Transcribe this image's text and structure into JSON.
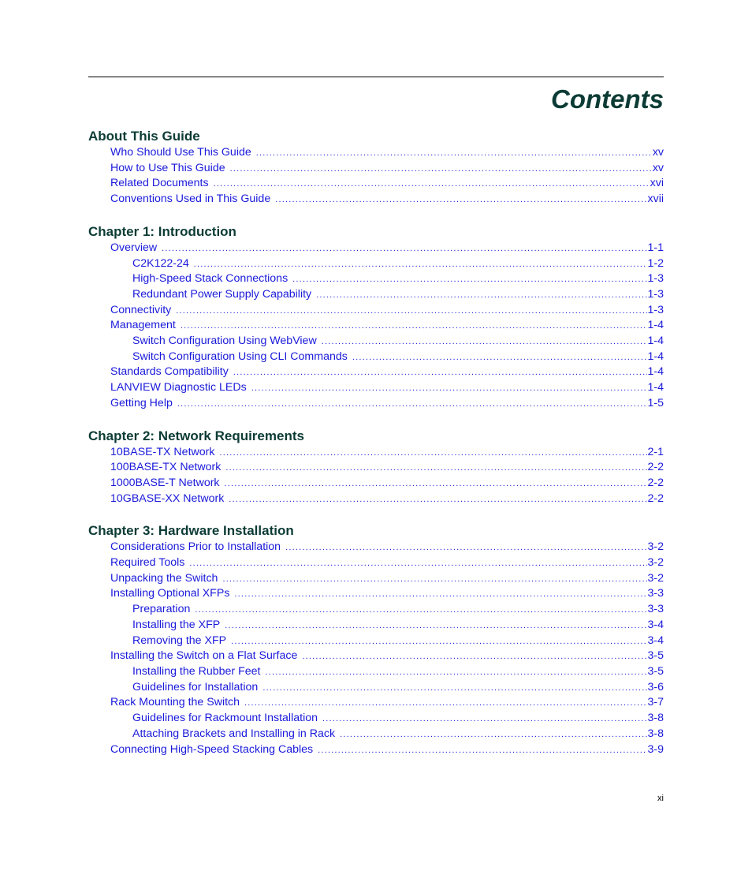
{
  "page": {
    "title": "Contents",
    "folio": "xi"
  },
  "sections": [
    {
      "title": "About This Guide",
      "entries": [
        {
          "level": 1,
          "label": "Who Should Use This Guide",
          "page": "xv"
        },
        {
          "level": 1,
          "label": "How to Use This Guide",
          "page": "xv"
        },
        {
          "level": 1,
          "label": "Related Documents",
          "page": "xvi"
        },
        {
          "level": 1,
          "label": "Conventions Used in This Guide",
          "page": "xvii"
        }
      ]
    },
    {
      "title": "Chapter 1: Introduction",
      "entries": [
        {
          "level": 1,
          "label": "Overview",
          "page": "1-1"
        },
        {
          "level": 2,
          "label": "C2K122-24",
          "page": "1-2"
        },
        {
          "level": 2,
          "label": "High-Speed Stack Connections",
          "page": "1-3"
        },
        {
          "level": 2,
          "label": "Redundant Power Supply Capability",
          "page": "1-3"
        },
        {
          "level": 1,
          "label": "Connectivity",
          "page": "1-3"
        },
        {
          "level": 1,
          "label": "Management",
          "page": "1-4"
        },
        {
          "level": 2,
          "label": "Switch Configuration Using WebView",
          "page": "1-4"
        },
        {
          "level": 2,
          "label": "Switch Configuration Using CLI Commands",
          "page": "1-4"
        },
        {
          "level": 1,
          "label": "Standards Compatibility",
          "page": "1-4"
        },
        {
          "level": 1,
          "label": "LANVIEW Diagnostic LEDs",
          "page": "1-4"
        },
        {
          "level": 1,
          "label": "Getting Help",
          "page": "1-5"
        }
      ]
    },
    {
      "title": "Chapter 2: Network Requirements",
      "entries": [
        {
          "level": 1,
          "label": "10BASE-TX Network",
          "page": "2-1"
        },
        {
          "level": 1,
          "label": "100BASE-TX Network",
          "page": "2-2"
        },
        {
          "level": 1,
          "label": "1000BASE-T Network",
          "page": "2-2"
        },
        {
          "level": 1,
          "label": "10GBASE-XX Network",
          "page": "2-2"
        }
      ]
    },
    {
      "title": "Chapter 3: Hardware Installation",
      "entries": [
        {
          "level": 1,
          "label": "Considerations Prior to Installation",
          "page": "3-2"
        },
        {
          "level": 1,
          "label": "Required Tools",
          "page": "3-2"
        },
        {
          "level": 1,
          "label": "Unpacking the Switch",
          "page": "3-2"
        },
        {
          "level": 1,
          "label": "Installing Optional XFPs",
          "page": "3-3"
        },
        {
          "level": 2,
          "label": "Preparation",
          "page": "3-3"
        },
        {
          "level": 2,
          "label": "Installing the XFP",
          "page": "3-4"
        },
        {
          "level": 2,
          "label": "Removing the XFP",
          "page": "3-4"
        },
        {
          "level": 1,
          "label": "Installing the Switch on a Flat Surface",
          "page": "3-5"
        },
        {
          "level": 2,
          "label": "Installing the Rubber Feet",
          "page": "3-5"
        },
        {
          "level": 2,
          "label": "Guidelines for Installation",
          "page": "3-6"
        },
        {
          "level": 1,
          "label": "Rack Mounting the Switch",
          "page": "3-7"
        },
        {
          "level": 2,
          "label": "Guidelines for Rackmount Installation",
          "page": "3-8"
        },
        {
          "level": 2,
          "label": "Attaching Brackets and Installing in Rack",
          "page": "3-8"
        },
        {
          "level": 1,
          "label": "Connecting High-Speed Stacking Cables",
          "page": "3-9"
        }
      ]
    }
  ]
}
